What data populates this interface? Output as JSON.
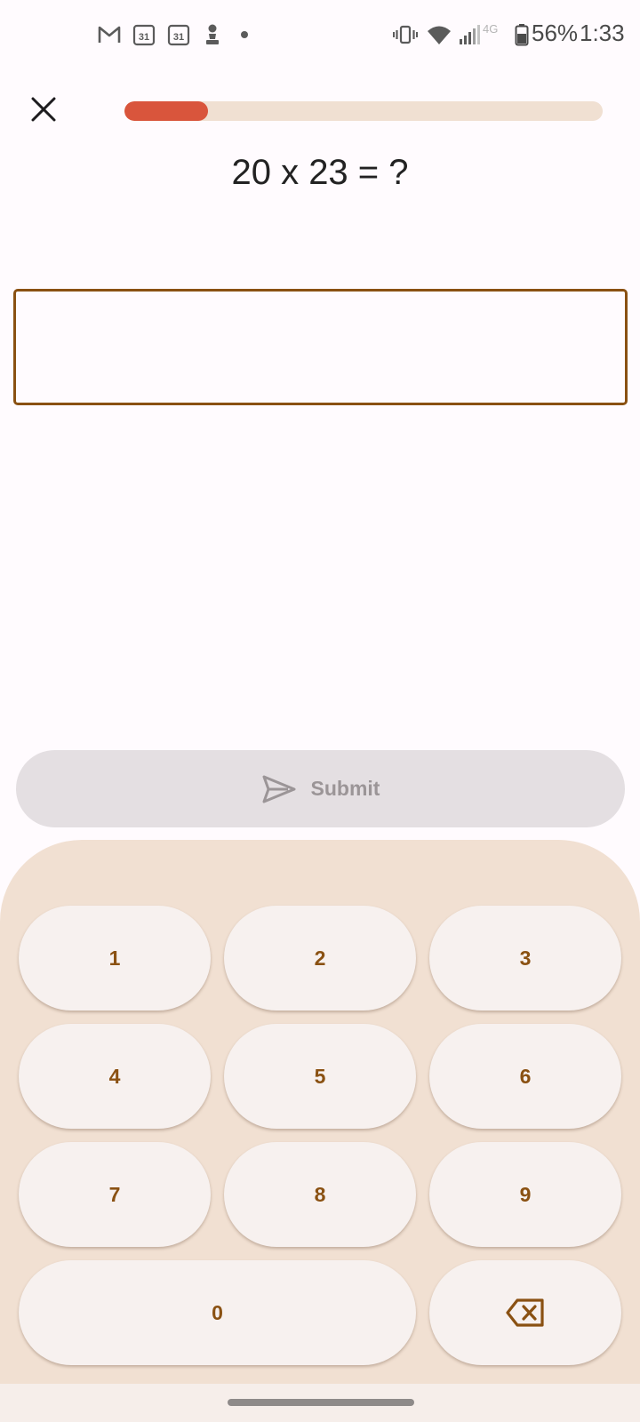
{
  "status_bar": {
    "icons": [
      "gmail-icon",
      "calendar-icon",
      "calendar-icon",
      "chess-pawn-icon",
      "dot-icon",
      "vibrate-icon",
      "wifi-icon",
      "signal-icon",
      "battery-icon"
    ],
    "calendar_day": "31",
    "network_label": "4G",
    "battery_percent": "56%",
    "time": "1:33"
  },
  "quiz": {
    "progress": 0.175,
    "question": "20 x 23 = ?",
    "answer_value": ""
  },
  "submit": {
    "label": "Submit",
    "enabled": false
  },
  "keypad": {
    "keys": [
      "1",
      "2",
      "3",
      "4",
      "5",
      "6",
      "7",
      "8",
      "9",
      "0"
    ],
    "backspace_icon": "backspace-icon"
  },
  "colors": {
    "accent": "#8a5112",
    "progress_fill": "#d9553c",
    "progress_track": "#f0e0d2",
    "keypad_bg": "#f1e0d2",
    "submit_disabled_bg": "#e4dfe2"
  }
}
